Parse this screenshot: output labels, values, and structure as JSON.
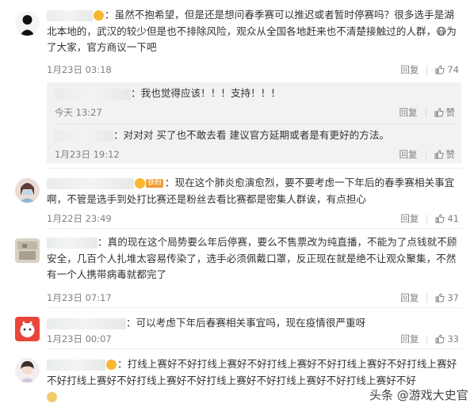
{
  "comments": [
    {
      "text": "：虽然不抱希望，但是还是想问春季赛可以推迟或者暂时停赛吗？很多选手是湖北本地的，武汉的较少但是也不排除风险，观众从全国各地赶来也不清楚接触过的人群，😷为了大家，官方商议一下吧",
      "time": "1月23日 03:18",
      "reply_label": "回复",
      "likes": "74"
    },
    {
      "text": "：现在这个肺炎愈演愈烈，要不要考虑一下年后的春季赛相关事宜啊，不管是选手到处打比赛还是粉丝去看比赛都是密集人群诶，有点担心",
      "fan_badge": "铁粉",
      "time": "1月22日 23:49",
      "reply_label": "回复",
      "likes": "41"
    },
    {
      "text": "：真的现在这个局势要么年后停赛，要么不售票改为纯直播，不能为了点钱就不顾安全，几百个人扎堆太容易传染了，选手必须佩戴口罩，反正现在就是绝不让观众聚集，不然有一个人携带病毒就都完了",
      "time": "1月23日 07:17",
      "reply_label": "回复",
      "likes": "37"
    },
    {
      "text": "：可以考虑下年后春赛相关事宜吗，现在疫情很严重呀",
      "time": "1月23日 00:07",
      "reply_label": "回复",
      "likes": "33"
    },
    {
      "text": "：打线上赛好不好打线上赛好不好打线上赛好不好打线上赛好不好打线上赛好不好打线上赛好不好打线上赛好不好打线上赛好不好打线上赛好不好打线上赛好不好"
    }
  ],
  "replies": [
    {
      "text": "：我也觉得应该！！！支持！！！",
      "time": "今天 13:27",
      "reply_label": "回复",
      "like_label": "赞"
    },
    {
      "text": "：对对对 买了也不敢去看 建议官方延期或者是有更好的方法。",
      "time": "1月23日 19:12",
      "reply_label": "回复",
      "like_label": "赞"
    }
  ],
  "watermark": "头条 @游戏大史官",
  "colors": {
    "accent": "#eb7350",
    "meta": "#808080",
    "reply_bg": "#f2f2f5"
  }
}
